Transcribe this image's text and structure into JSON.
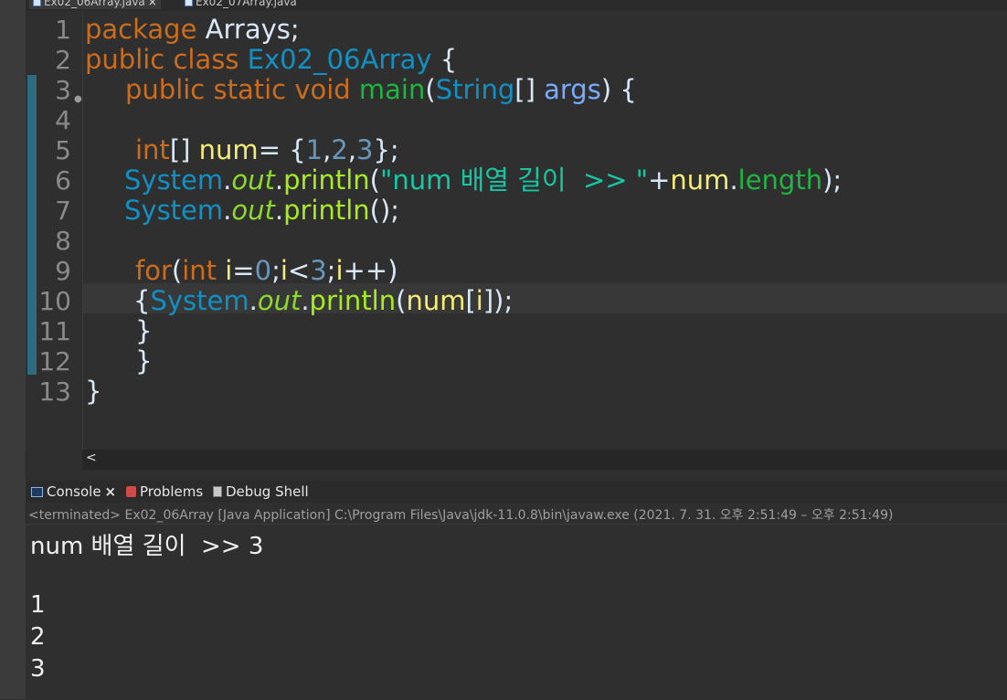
{
  "tabs": [
    {
      "label": "Ex02_06Array.java",
      "active": true
    },
    {
      "label": "Ex02_07Array.java",
      "active": false
    }
  ],
  "editor": {
    "line_numbers": [
      "1",
      "2",
      "3",
      "4",
      "5",
      "6",
      "7",
      "8",
      "9",
      "10",
      "11",
      "12",
      "13"
    ],
    "lines": {
      "l1": {
        "kw": "package",
        "name": " Arrays;"
      },
      "l2": {
        "kw": "public class",
        "cls": " Ex02_06Array",
        "rest": " {"
      },
      "l3": {
        "kw": "public static void",
        "mt": " main",
        "p1": "(",
        "ty": "String",
        "p2": "[] ",
        "prm": "args",
        "rest": ") {"
      },
      "l5": {
        "kw": "int",
        "p1": "[] ",
        "var": "num",
        "p2": "= {",
        "n1": "1",
        "c1": ",",
        "n2": "2",
        "c2": ",",
        "n3": "3",
        "rest": "};"
      },
      "l6": {
        "cls": "System",
        "dot1": ".",
        "fld": "out",
        "dot2": ".",
        "mt": "println",
        "p1": "(",
        "str": "\"num 배열 길이  >> \"",
        "plus": "+",
        "var": "num",
        "dot3": ".",
        "fld2": "length",
        "rest": ");"
      },
      "l7": {
        "cls": "System",
        "dot1": ".",
        "fld": "out",
        "dot2": ".",
        "mt": "println",
        "rest": "();"
      },
      "l9": {
        "kw": "for",
        "p1": "(",
        "kw2": "int",
        "sp": " ",
        "var": "i",
        "eq": "=",
        "n1": "0",
        "semi": ";",
        "var2": "i",
        "lt": "<",
        "n2": "3",
        "semi2": ";",
        "var3": "i",
        "rest": "++)"
      },
      "l10": {
        "p1": "{",
        "cls": "System",
        "dot1": ".",
        "fld": "out",
        "dot2": ".",
        "mt": "println",
        "p2": "(",
        "var": "num",
        "p3": "[",
        "var2": "i",
        "rest": "]);"
      },
      "l11": {
        "rest": "}"
      },
      "l12": {
        "rest": "}"
      },
      "l13": {
        "rest": "}"
      }
    }
  },
  "scroll_left_arrow": "<",
  "console_tabs": {
    "console": "Console",
    "console_close": "×",
    "problems": "Problems",
    "debug": "Debug Shell"
  },
  "console": {
    "status": "<terminated> Ex02_06Array [Java Application] C:\\Program Files\\Java\\jdk-11.0.8\\bin\\javaw.exe  (2021. 7. 31. 오후 2:51:49 – 오후 2:51:49)",
    "output": [
      "num 배열 길이  >> 3",
      "",
      "1",
      "2",
      "3"
    ]
  },
  "colors": {
    "keyword": "#cc6c1d",
    "type": "#1290c3",
    "string": "#17c6a3",
    "number": "#6897bb",
    "variable": "#f3ec79",
    "method": "#a7ec21"
  }
}
